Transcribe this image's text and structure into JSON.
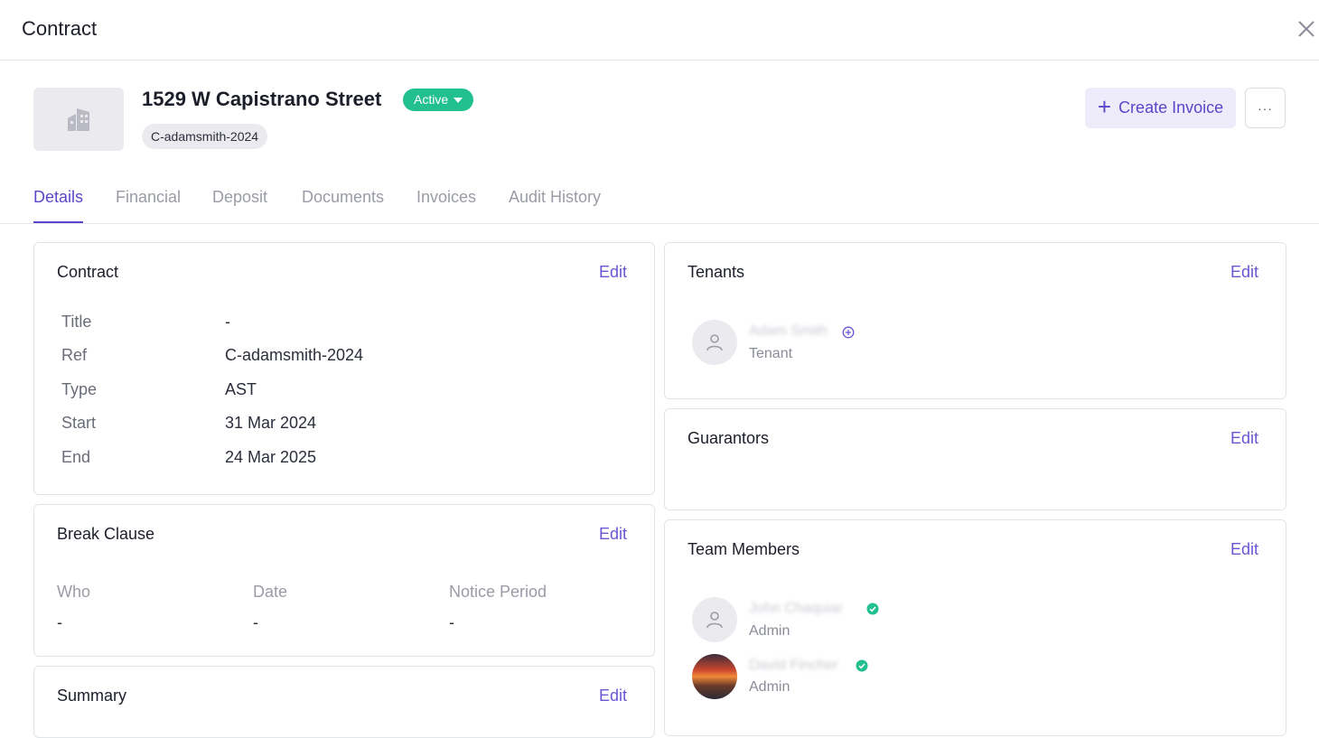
{
  "modal": {
    "title": "Contract"
  },
  "property": {
    "title": "1529 W Capistrano Street",
    "status": "Active",
    "ref_chip": "C-adamsmith-2024",
    "colors": {
      "status": "#22c08f",
      "accent": "#5b46c9"
    }
  },
  "actions": {
    "create_invoice": "Create Invoice",
    "more": "···"
  },
  "tabs": [
    {
      "label": "Details",
      "active": true
    },
    {
      "label": "Financial"
    },
    {
      "label": "Deposit"
    },
    {
      "label": "Documents"
    },
    {
      "label": "Invoices"
    },
    {
      "label": "Audit History"
    }
  ],
  "contract_card": {
    "title": "Contract",
    "edit": "Edit",
    "rows": [
      {
        "label": "Title",
        "value": "-"
      },
      {
        "label": "Ref",
        "value": "C-adamsmith-2024"
      },
      {
        "label": "Type",
        "value": "AST"
      },
      {
        "label": "Start",
        "value": "31 Mar 2024"
      },
      {
        "label": "End",
        "value": "24 Mar 2025"
      }
    ]
  },
  "break_clause": {
    "title": "Break Clause",
    "edit": "Edit",
    "columns": [
      "Who",
      "Date",
      "Notice Period"
    ],
    "values": [
      "-",
      "-",
      "-"
    ]
  },
  "summary": {
    "title": "Summary",
    "edit": "Edit"
  },
  "tenants": {
    "title": "Tenants",
    "edit": "Edit",
    "people": [
      {
        "name": "Adam Smith",
        "role": "Tenant",
        "icon": "plus-circle-icon"
      }
    ]
  },
  "guarantors": {
    "title": "Guarantors",
    "edit": "Edit"
  },
  "team_members": {
    "title": "Team Members",
    "edit": "Edit",
    "people": [
      {
        "name": "John Chaquiar",
        "role": "Admin",
        "icon": "verified-check-icon"
      },
      {
        "name": "David Fincher",
        "role": "Admin",
        "icon": "verified-check-icon"
      }
    ]
  }
}
